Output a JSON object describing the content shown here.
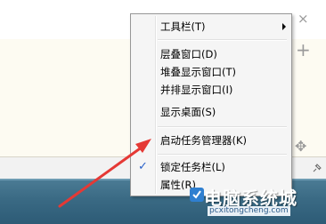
{
  "context_menu": {
    "items": [
      {
        "label": "工具栏(T)",
        "submenu": true
      },
      {
        "label": "层叠窗口(D)"
      },
      {
        "label": "堆叠显示窗口(T)"
      },
      {
        "label": "并排显示窗口(I)"
      },
      {
        "label": "显示桌面(S)"
      },
      {
        "label": "启动任务管理器(K)"
      },
      {
        "label": "锁定任务栏(L)",
        "checked": true,
        "check_mark": "✓"
      },
      {
        "label": "属性(R)"
      }
    ]
  },
  "watermark": {
    "title": "电脑系统城",
    "url": "pcxitongcheng.com"
  },
  "annotation": {
    "color": "#e53935"
  },
  "edge_icons": {
    "close": "×",
    "plus": "+",
    "move": "✥",
    "pin": "⊿"
  }
}
